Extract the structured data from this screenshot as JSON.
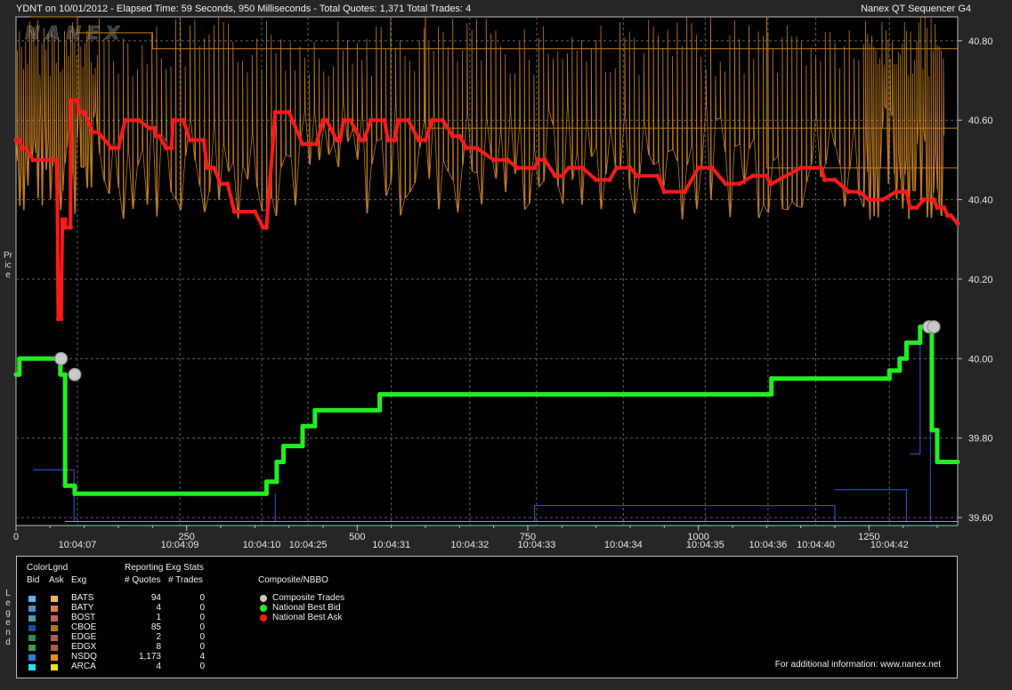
{
  "header": {
    "left": "YDNT on 10/01/2012  -  Elapsed Time: 59 Seconds, 950 Milliseconds  -  Total Quotes: 1,371  Total Trades: 4",
    "right": "Nanex QT Sequencer G4",
    "watermark": "NANEX"
  },
  "side_labels": {
    "price": "Price",
    "legend": "Legend"
  },
  "chart_data": {
    "type": "line",
    "x_axis": {
      "range": [
        0,
        1380
      ],
      "major_ticks": [
        0,
        250,
        500,
        750,
        1000,
        1250
      ]
    },
    "y_axis": {
      "range": [
        39.58,
        40.86
      ],
      "ticks": [
        39.6,
        39.8,
        40.0,
        40.2,
        40.4,
        40.6,
        40.8
      ],
      "tick_labels": [
        "39.60",
        "39.80",
        "40.00",
        "40.20",
        "40.40",
        "40.60",
        "40.80"
      ]
    },
    "time_labels": [
      {
        "x": 90,
        "label": "10:04:07"
      },
      {
        "x": 240,
        "label": "10:04:09"
      },
      {
        "x": 360,
        "label": "10:04:10"
      },
      {
        "x": 428,
        "label": "10:04:25"
      },
      {
        "x": 550,
        "label": "10:04:31"
      },
      {
        "x": 665,
        "label": "10:04:32"
      },
      {
        "x": 763,
        "label": "10:04:33"
      },
      {
        "x": 890,
        "label": "10:04:34"
      },
      {
        "x": 1010,
        "label": "10:04:35"
      },
      {
        "x": 1102,
        "label": "10:04:36"
      },
      {
        "x": 1172,
        "label": "10:04:40"
      },
      {
        "x": 1280,
        "label": "10:04:42"
      }
    ],
    "grid": true,
    "series": [
      {
        "name": "National Best Bid",
        "color": "#22ee22",
        "x": [
          0,
          5,
          5,
          65,
          65,
          72,
          72,
          86,
          86,
          367,
          367,
          382,
          382,
          392,
          392,
          420,
          420,
          438,
          438,
          533,
          533,
          1107,
          1107,
          1280,
          1280,
          1295,
          1295,
          1305,
          1305,
          1325,
          1325,
          1342,
          1342,
          1350,
          1350,
          1380
        ],
        "y": [
          39.96,
          39.96,
          40.0,
          40.0,
          39.96,
          39.96,
          39.68,
          39.68,
          39.66,
          39.66,
          39.69,
          39.69,
          39.74,
          39.74,
          39.78,
          39.78,
          39.83,
          39.83,
          39.87,
          39.87,
          39.91,
          39.91,
          39.95,
          39.95,
          39.97,
          39.97,
          40.0,
          40.0,
          40.04,
          40.04,
          40.08,
          40.08,
          39.82,
          39.82,
          39.74,
          39.74
        ]
      },
      {
        "name": "National Best Ask",
        "color": "#ff1a1a",
        "x": [
          0,
          6,
          8,
          15,
          25,
          60,
          62,
          66,
          68,
          72,
          72,
          80,
          80,
          90,
          92,
          100,
          112,
          120,
          140,
          150,
          160,
          180,
          195,
          203,
          205,
          210,
          220,
          228,
          230,
          245,
          255,
          275,
          280,
          290,
          300,
          310,
          320,
          350,
          362,
          367,
          380,
          400,
          420,
          440,
          450,
          455,
          470,
          475,
          480,
          490,
          505,
          510,
          520,
          540,
          545,
          555,
          560,
          575,
          590,
          600,
          610,
          625,
          640,
          650,
          660,
          675,
          700,
          720,
          735,
          760,
          765,
          775,
          790,
          800,
          810,
          830,
          850,
          870,
          880,
          900,
          910,
          940,
          950,
          980,
          1000,
          1020,
          1040,
          1060,
          1080,
          1100,
          1105,
          1107,
          1150,
          1180,
          1185,
          1200,
          1220,
          1235,
          1250,
          1270,
          1290,
          1305,
          1310,
          1320,
          1330,
          1345,
          1350,
          1360,
          1365,
          1370,
          1380
        ],
        "y": [
          40.55,
          40.55,
          40.53,
          40.53,
          40.5,
          40.5,
          40.1,
          40.1,
          40.35,
          40.35,
          40.33,
          40.33,
          40.65,
          40.65,
          40.62,
          40.62,
          40.57,
          40.57,
          40.53,
          40.53,
          40.6,
          40.6,
          40.58,
          40.58,
          40.56,
          40.56,
          40.53,
          40.53,
          40.6,
          40.6,
          40.55,
          40.55,
          40.48,
          40.48,
          40.44,
          40.44,
          40.37,
          40.37,
          40.33,
          40.33,
          40.62,
          40.62,
          40.54,
          40.54,
          40.6,
          40.6,
          40.55,
          40.55,
          40.6,
          40.6,
          40.55,
          40.55,
          40.6,
          40.6,
          40.55,
          40.55,
          40.6,
          40.6,
          40.55,
          40.55,
          40.6,
          40.6,
          40.56,
          40.56,
          40.53,
          40.53,
          40.5,
          40.5,
          40.48,
          40.48,
          40.5,
          40.5,
          40.46,
          40.46,
          40.48,
          40.48,
          40.45,
          40.45,
          40.48,
          40.48,
          40.46,
          40.46,
          40.42,
          40.42,
          40.48,
          40.48,
          40.44,
          40.44,
          40.46,
          40.46,
          40.44,
          40.44,
          40.48,
          40.48,
          40.45,
          40.45,
          40.42,
          40.42,
          40.4,
          40.4,
          40.42,
          40.42,
          40.38,
          40.38,
          40.4,
          40.4,
          40.38,
          40.38,
          40.36,
          40.36,
          40.34
        ]
      },
      {
        "name": "Composite Trades",
        "color": "#c8c8c8",
        "x": [
          66,
          86,
          1338,
          1345
        ],
        "y": [
          40.0,
          39.96,
          40.08,
          40.08
        ]
      }
    ]
  },
  "legend": {
    "title": "ColorLgnd",
    "headers": {
      "bid": "Bid",
      "ask": "Ask",
      "exg": "Exg",
      "quotes": "# Quotes",
      "trades": "# Trades"
    },
    "stats_title": "Reporting Exg Stats",
    "composite_title": "Composite/NBBO",
    "exchanges": [
      {
        "name": "BATS",
        "quotes": "94",
        "trades": "0",
        "bid_color": "#5ab4f0",
        "ask_color": "#f0b464"
      },
      {
        "name": "BATY",
        "quotes": "4",
        "trades": "0",
        "bid_color": "#4c8cc8",
        "ask_color": "#e08030"
      },
      {
        "name": "BOST",
        "quotes": "1",
        "trades": "0",
        "bid_color": "#4e9ca8",
        "ask_color": "#c86060"
      },
      {
        "name": "CBOE",
        "quotes": "85",
        "trades": "0",
        "bid_color": "#1a4aa8",
        "ask_color": "#b87810"
      },
      {
        "name": "EDGE",
        "quotes": "2",
        "trades": "0",
        "bid_color": "#2c8c5a",
        "ask_color": "#b06050"
      },
      {
        "name": "EDGX",
        "quotes": "8",
        "trades": "0",
        "bid_color": "#3c9c4c",
        "ask_color": "#b05844"
      },
      {
        "name": "NSDQ",
        "quotes": "1,173",
        "trades": "4",
        "bid_color": "#2a80d8",
        "ask_color": "#f08c1a"
      },
      {
        "name": "ARCA",
        "quotes": "4",
        "trades": "0",
        "bid_color": "#28e0f0",
        "ask_color": "#f0e020"
      }
    ],
    "composite": [
      {
        "label": "Composite Trades",
        "color": "#c8c8c8"
      },
      {
        "label": "National Best Bid",
        "color": "#22ee22"
      },
      {
        "label": "National Best Ask",
        "color": "#ff1a1a"
      }
    ],
    "footer": "For additional information: www.nanex.net"
  }
}
